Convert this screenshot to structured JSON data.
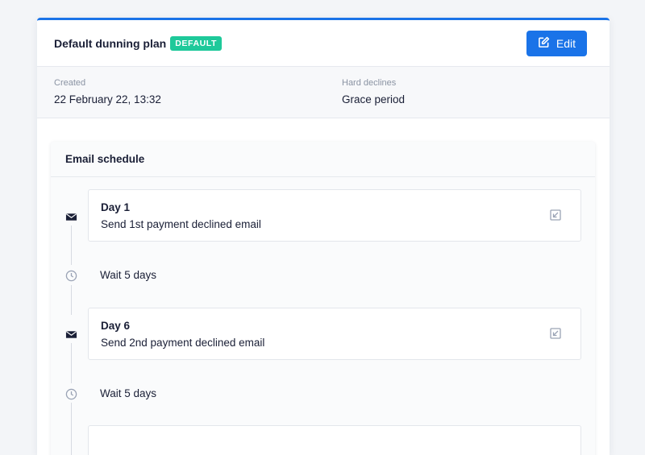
{
  "header": {
    "title": "Default dunning plan",
    "badge": "DEFAULT",
    "edit_label": "Edit",
    "accent": "#1a73e8",
    "badge_color": "#1ec99a"
  },
  "meta": {
    "created_label": "Created",
    "created_value": "22 February 22, 13:32",
    "hard_declines_label": "Hard declines",
    "hard_declines_value": "Grace period"
  },
  "schedule": {
    "title": "Email schedule",
    "steps": [
      {
        "type": "email",
        "icon": "envelope-icon",
        "day": "Day 1",
        "description": "Send 1st payment declined email"
      },
      {
        "type": "wait",
        "icon": "clock-icon",
        "text": "Wait 5 days"
      },
      {
        "type": "email",
        "icon": "envelope-icon",
        "day": "Day 6",
        "description": "Send 2nd payment declined email"
      },
      {
        "type": "wait",
        "icon": "clock-icon",
        "text": "Wait 5 days"
      }
    ]
  }
}
